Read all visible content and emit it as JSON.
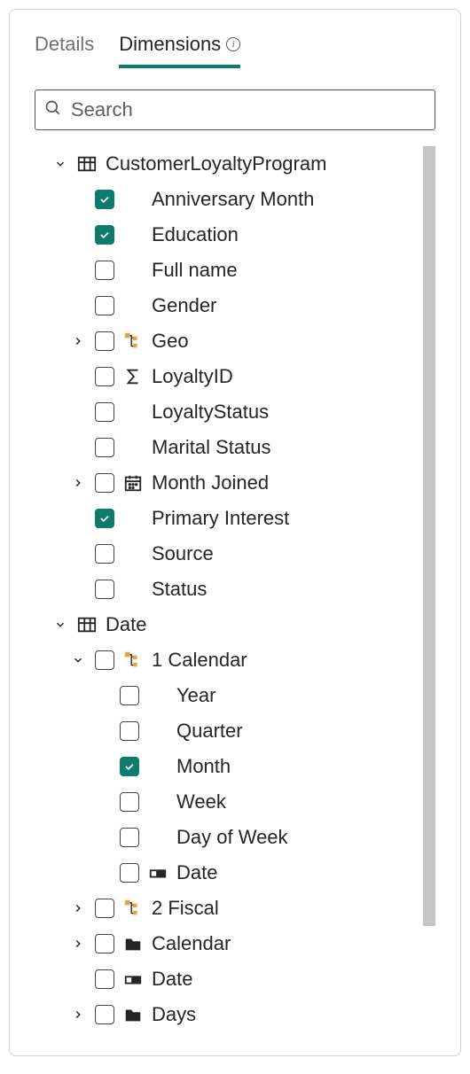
{
  "tabs": {
    "details": "Details",
    "dimensions": "Dimensions"
  },
  "search": {
    "placeholder": "Search"
  },
  "tree": {
    "group1": {
      "label": "CustomerLoyaltyProgram",
      "items": {
        "anniv": "Anniversary Month",
        "edu": "Education",
        "full": "Full name",
        "gender": "Gender",
        "geo": "Geo",
        "loyid": "LoyaltyID",
        "loystat": "LoyaltyStatus",
        "marital": "Marital Status",
        "monthj": "Month Joined",
        "primary": "Primary Interest",
        "source": "Source",
        "status": "Status"
      }
    },
    "group2": {
      "label": "Date",
      "calendar1": {
        "label": "1 Calendar",
        "year": "Year",
        "quarter": "Quarter",
        "month": "Month",
        "week": "Week",
        "dow": "Day of Week",
        "date": "Date"
      },
      "fiscal": "2 Fiscal",
      "calendar": "Calendar",
      "date": "Date",
      "days": "Days"
    }
  }
}
